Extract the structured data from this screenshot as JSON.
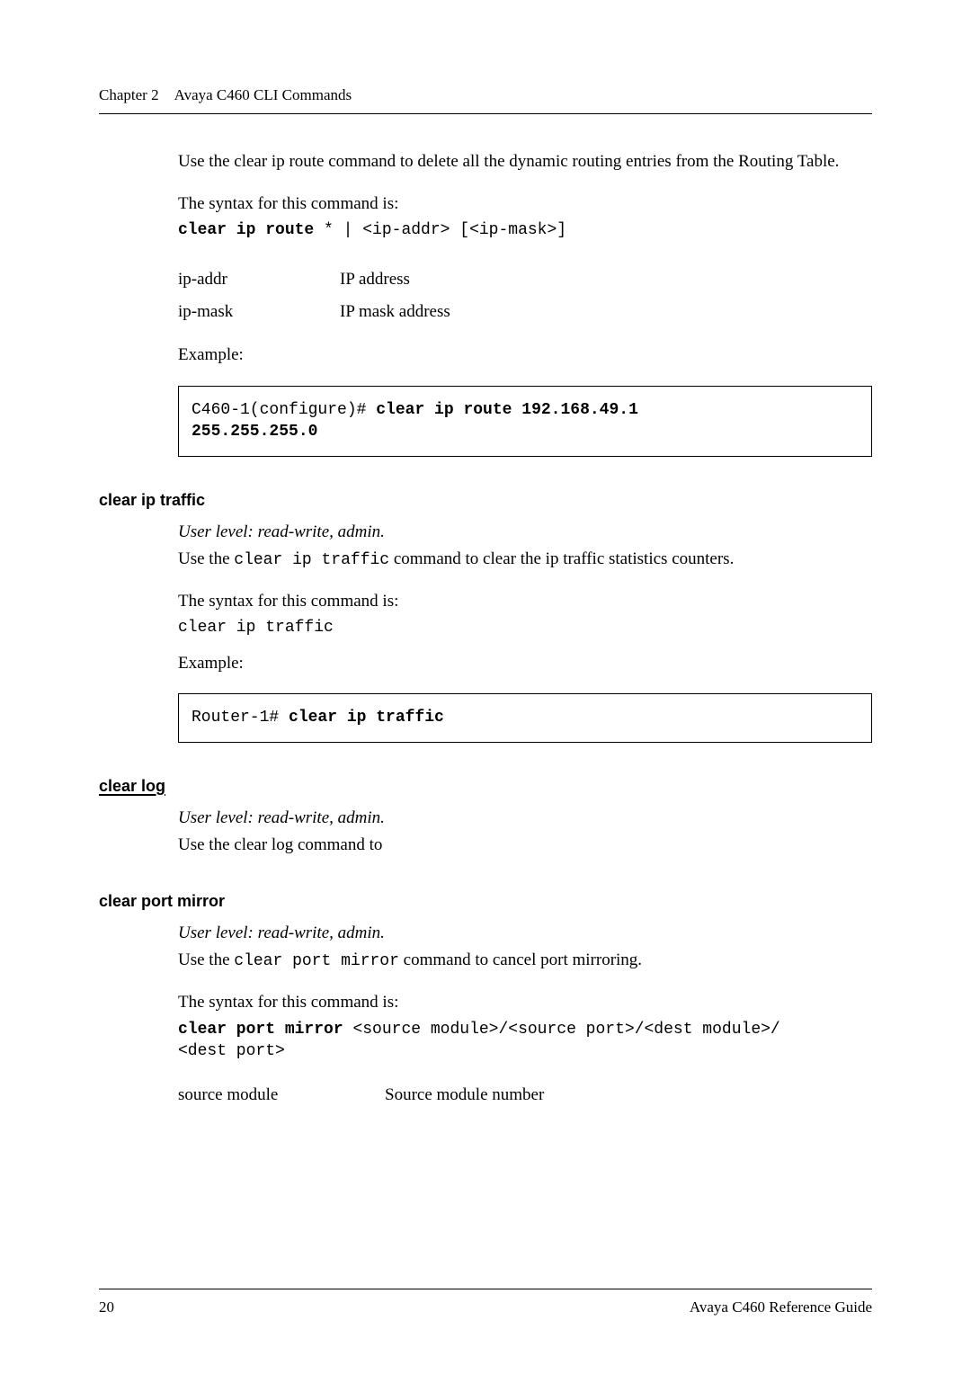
{
  "running_head": {
    "chapter": "Chapter 2",
    "title": "Avaya C460 CLI Commands"
  },
  "intro": {
    "p1": "Use the clear ip route command to delete all the dynamic routing entries from the Routing Table.",
    "syntax_label": "The syntax for this command is:",
    "cmd_bold": "clear ip route",
    "cmd_rest": " * | <ip-addr> [<ip-mask>]",
    "params": {
      "ipaddr_name": "ip-addr",
      "ipaddr_desc": "IP address",
      "ipmask_name": "ip-mask",
      "ipmask_desc": "IP mask address"
    },
    "example_label": "Example:",
    "example_line1_pre": "C460-1(configure)# ",
    "example_line1_bold": "clear ip route 192.168.49.1",
    "example_line2_bold": "255.255.255.0"
  },
  "sec_traffic": {
    "heading": "clear ip traffic",
    "userlevel": "User level: read-write, admin.",
    "desc_pre": "Use the ",
    "desc_mono": "clear ip traffic",
    "desc_post": " command to clear the ip traffic statistics counters.",
    "syntax_label": "The syntax for this command is:",
    "syntax_cmd": "clear ip traffic",
    "example_label": "Example:",
    "example_pre": "Router-1# ",
    "example_bold": "clear ip traffic"
  },
  "sec_log": {
    "heading": "clear log",
    "userlevel": "User level: read-write, admin.",
    "desc": "Use the clear log command to"
  },
  "sec_mirror": {
    "heading": "clear port mirror",
    "userlevel": "User level: read-write, admin.",
    "desc_pre": "Use the ",
    "desc_mono": "clear port mirror",
    "desc_post": " command to cancel port mirroring.",
    "syntax_label": "The syntax for this command is:",
    "cmd_bold": "clear port mirror",
    "cmd_rest": " <source module>/<source port>/<dest module>/",
    "cmd_line2": "<dest port>",
    "param_name": "source module",
    "param_desc": "Source module number"
  },
  "footer": {
    "page": "20",
    "title": "Avaya C460 Reference Guide"
  }
}
